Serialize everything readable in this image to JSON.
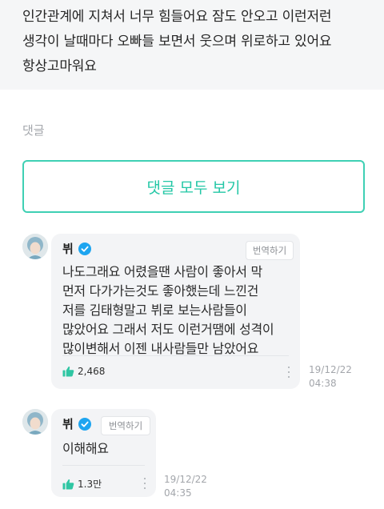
{
  "post": {
    "text": "인간관계에 지쳐서 너무 힘들어요 잠도 안오고 이런저런\n생각이 날때마다 오빠들 보면서 웃으며 위로하고 있어요\n항상고마워요"
  },
  "comments_section": {
    "heading": "댓글",
    "view_all_label": "댓글 모두 보기"
  },
  "replies": [
    {
      "author": "뷔",
      "translate_label": "번역하기",
      "text": "나도그래요 어렸을땐 사람이 좋아서 막\n먼저 다가가는것도 좋아했는데 느낀건\n저를 김태형말고 뷔로 보는사람들이\n많았어요 그래서 저도 이런거땜에 성격이\n많이변해서 이젠 내사람들만 남았어요",
      "likes": "2,468",
      "timestamp": "19/12/22\n04:38"
    },
    {
      "author": "뷔",
      "translate_label": "번역하기",
      "text": "이해해요",
      "likes": "1.3만",
      "timestamp": "19/12/22\n04:35"
    }
  ],
  "colors": {
    "accent": "#3fd0b4",
    "verified": "#1ea5f0",
    "like": "#2fc6a3"
  },
  "icons": {
    "verified": "verified-badge-icon",
    "like": "thumbs-up-icon",
    "more": "more-vertical-icon"
  }
}
